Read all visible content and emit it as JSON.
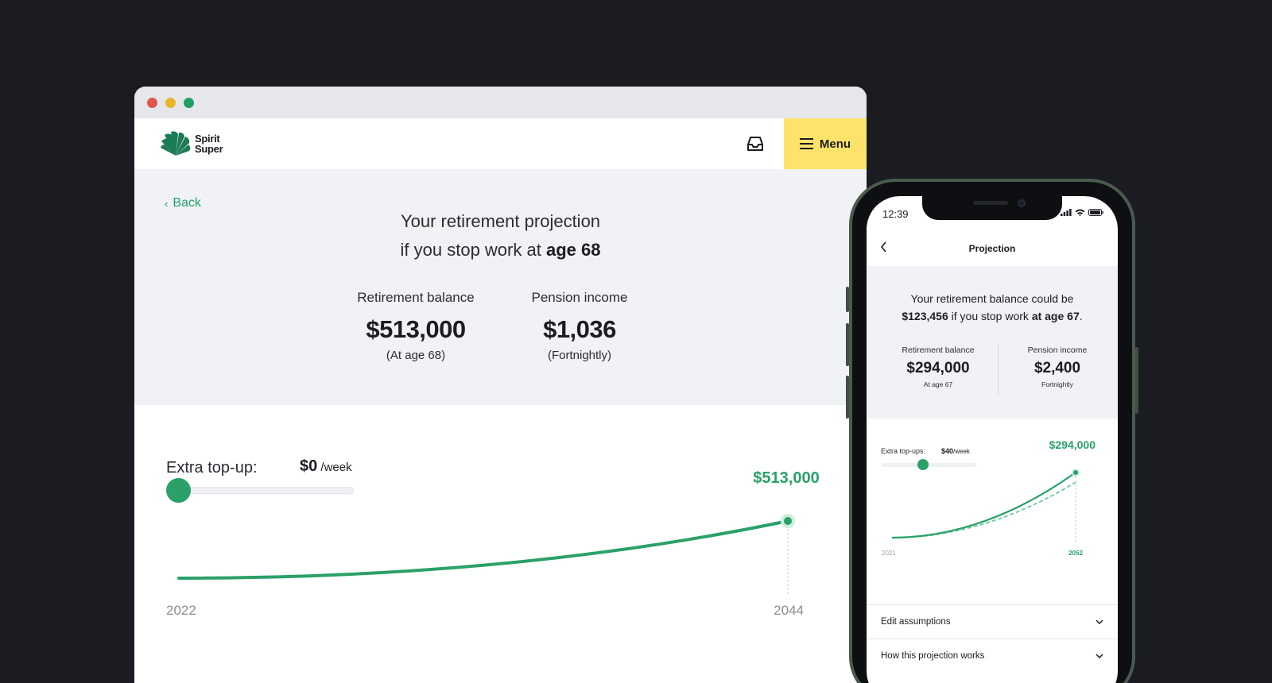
{
  "browser": {
    "dots": [
      "#e0574b",
      "#e9b32a",
      "#1fa065"
    ],
    "logo": {
      "line1": "Spirit",
      "line2": "Super",
      "color": "#1c7a55"
    },
    "inbox_icon": "inbox-icon",
    "menu_label": "Menu",
    "back_label": "Back",
    "title_line1": "Your retirement projection",
    "title_line2_prefix": "if you stop work at ",
    "title_line2_bold": "age 68",
    "stats": [
      {
        "label": "Retirement balance",
        "value": "$513,000",
        "sub": "(At age 68)"
      },
      {
        "label": "Pension income",
        "value": "$1,036",
        "sub": "(Fortnightly)"
      }
    ],
    "topup_label": "Extra top-up:",
    "topup_value": "$0",
    "topup_unit": " /week",
    "topup_amount": 0
  },
  "chart_data": [
    {
      "type": "line",
      "x": [
        2022,
        2044
      ],
      "series": [
        {
          "values": [
            0,
            513000
          ]
        }
      ],
      "end_label": "$513,000",
      "x_tick_labels": [
        "2022",
        "2044"
      ],
      "color": "#2aa168"
    },
    {
      "type": "line",
      "x": [
        2021,
        2052
      ],
      "series": [
        {
          "values": [
            0,
            294000
          ],
          "style": "solid"
        },
        {
          "values": [
            0,
            250000
          ],
          "style": "dashed"
        }
      ],
      "end_label": "$294,000",
      "x_tick_labels": [
        "2021",
        "2052"
      ],
      "color": "#2aa168"
    }
  ],
  "phone": {
    "time": "12:39",
    "nav_title": "Projection",
    "proj_line1": "Your retirement balance could be",
    "proj_line2_amount": "$123,456",
    "proj_line2_mid": " if you stop work ",
    "proj_line2_bold": "at age 67",
    "proj_line2_end": ".",
    "stats": [
      {
        "label": "Retirement balance",
        "value": "$294,000",
        "sub": "At age 67"
      },
      {
        "label": "Pension income",
        "value": "$2,400",
        "sub": "Fortnightly"
      }
    ],
    "topup_label": "Extra top-ups:",
    "topup_value": "$40",
    "topup_unit": "/week",
    "accordions": [
      "Edit assumptions",
      "How this projection works"
    ]
  }
}
